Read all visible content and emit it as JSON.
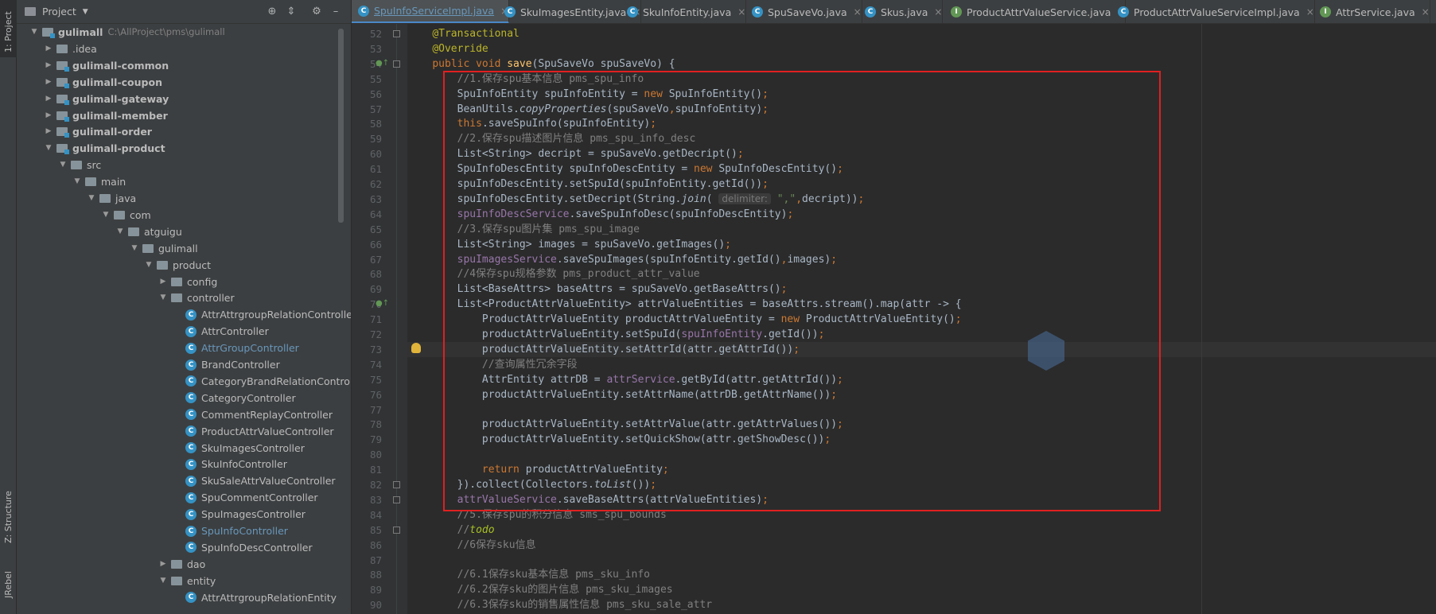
{
  "left_strip": {
    "project_tab": "1: Project",
    "structure_tab": "Z: Structure",
    "jrebel_tab": "JRebel"
  },
  "project_panel": {
    "title": "Project",
    "tree": [
      {
        "label": "gulimall",
        "path": "C:\\AllProject\\pms\\gulimall",
        "level": 0,
        "expanded": true,
        "kind": "module",
        "bold": true
      },
      {
        "label": ".idea",
        "level": 1,
        "expanded": false,
        "kind": "folder"
      },
      {
        "label": "gulimall-common",
        "level": 1,
        "expanded": false,
        "kind": "module",
        "bold": true
      },
      {
        "label": "gulimall-coupon",
        "level": 1,
        "expanded": false,
        "kind": "module",
        "bold": true
      },
      {
        "label": "gulimall-gateway",
        "level": 1,
        "expanded": false,
        "kind": "module",
        "bold": true
      },
      {
        "label": "gulimall-member",
        "level": 1,
        "expanded": false,
        "kind": "module",
        "bold": true
      },
      {
        "label": "gulimall-order",
        "level": 1,
        "expanded": false,
        "kind": "module",
        "bold": true
      },
      {
        "label": "gulimall-product",
        "level": 1,
        "expanded": true,
        "kind": "module",
        "bold": true
      },
      {
        "label": "src",
        "level": 2,
        "expanded": true,
        "kind": "folder"
      },
      {
        "label": "main",
        "level": 3,
        "expanded": true,
        "kind": "folder"
      },
      {
        "label": "java",
        "level": 4,
        "expanded": true,
        "kind": "folder"
      },
      {
        "label": "com",
        "level": 5,
        "expanded": true,
        "kind": "folder"
      },
      {
        "label": "atguigu",
        "level": 6,
        "expanded": true,
        "kind": "folder"
      },
      {
        "label": "gulimall",
        "level": 7,
        "expanded": true,
        "kind": "folder"
      },
      {
        "label": "product",
        "level": 8,
        "expanded": true,
        "kind": "folder"
      },
      {
        "label": "config",
        "level": 9,
        "expanded": false,
        "kind": "folder"
      },
      {
        "label": "controller",
        "level": 9,
        "expanded": true,
        "kind": "folder"
      },
      {
        "label": "AttrAttrgroupRelationController",
        "level": 10,
        "kind": "class"
      },
      {
        "label": "AttrController",
        "level": 10,
        "kind": "class"
      },
      {
        "label": "AttrGroupController",
        "level": 10,
        "kind": "class",
        "blue": true
      },
      {
        "label": "BrandController",
        "level": 10,
        "kind": "class"
      },
      {
        "label": "CategoryBrandRelationController",
        "level": 10,
        "kind": "class"
      },
      {
        "label": "CategoryController",
        "level": 10,
        "kind": "class"
      },
      {
        "label": "CommentReplayController",
        "level": 10,
        "kind": "class"
      },
      {
        "label": "ProductAttrValueController",
        "level": 10,
        "kind": "class"
      },
      {
        "label": "SkuImagesController",
        "level": 10,
        "kind": "class"
      },
      {
        "label": "SkuInfoController",
        "level": 10,
        "kind": "class"
      },
      {
        "label": "SkuSaleAttrValueController",
        "level": 10,
        "kind": "class"
      },
      {
        "label": "SpuCommentController",
        "level": 10,
        "kind": "class"
      },
      {
        "label": "SpuImagesController",
        "level": 10,
        "kind": "class"
      },
      {
        "label": "SpuInfoController",
        "level": 10,
        "kind": "class",
        "blue": true
      },
      {
        "label": "SpuInfoDescController",
        "level": 10,
        "kind": "class"
      },
      {
        "label": "dao",
        "level": 9,
        "expanded": false,
        "kind": "folder"
      },
      {
        "label": "entity",
        "level": 9,
        "expanded": true,
        "kind": "folder"
      },
      {
        "label": "AttrAttrgroupRelationEntity",
        "level": 10,
        "kind": "class"
      }
    ]
  },
  "tabs": [
    {
      "label": "SpuInfoServiceImpl.java",
      "icon": "C",
      "active": true
    },
    {
      "label": "SkuImagesEntity.java",
      "icon": "C"
    },
    {
      "label": "SkuInfoEntity.java",
      "icon": "C"
    },
    {
      "label": "SpuSaveVo.java",
      "icon": "C"
    },
    {
      "label": "Skus.java",
      "icon": "C"
    },
    {
      "label": "ProductAttrValueService.java",
      "icon": "I"
    },
    {
      "label": "ProductAttrValueServiceImpl.java",
      "icon": "C"
    },
    {
      "label": "AttrService.java",
      "icon": "I"
    }
  ],
  "editor": {
    "lines": [
      {
        "n": "52",
        "html": "    <span class='an'>@Transactional</span>"
      },
      {
        "n": "53",
        "html": "    <span class='an'>@Override</span>"
      },
      {
        "n": "54",
        "html": "    <span class='k'>public void</span> <span class='fn'>save</span>(SpuSaveVo spuSaveVo) {"
      },
      {
        "n": "55",
        "html": "        <span class='cm'>//1.保存spu基本信息 pms_spu_info</span>"
      },
      {
        "n": "56",
        "html": "        SpuInfoEntity spuInfoEntity = <span class='k'>new</span> SpuInfoEntity()<span class='k'>;</span>"
      },
      {
        "n": "57",
        "html": "        BeanUtils.<span class='it'>copyProperties</span>(spuSaveVo<span class='k'>,</span>spuInfoEntity)<span class='k'>;</span>"
      },
      {
        "n": "58",
        "html": "        <span class='k'>this</span>.saveSpuInfo(spuInfoEntity)<span class='k'>;</span>"
      },
      {
        "n": "59",
        "html": "        <span class='cm'>//2.保存spu描述图片信息 pms_spu_info_desc</span>"
      },
      {
        "n": "60",
        "html": "        List&lt;String&gt; decript = spuSaveVo.getDecript()<span class='k'>;</span>"
      },
      {
        "n": "61",
        "html": "        SpuInfoDescEntity spuInfoDescEntity = <span class='k'>new</span> SpuInfoDescEntity()<span class='k'>;</span>"
      },
      {
        "n": "62",
        "html": "        spuInfoDescEntity.setSpuId(spuInfoEntity.getId())<span class='k'>;</span>"
      },
      {
        "n": "63",
        "html": "        spuInfoDescEntity.setDecript(String.<span class='it'>join</span>( <span class='hint'>delimiter:</span> <span class='st'>\",\"</span><span class='k'>,</span>decript))<span class='k'>;</span>"
      },
      {
        "n": "64",
        "html": "        <span class='fd'>spuInfoDescService</span>.saveSpuInfoDesc(spuInfoDescEntity)<span class='k'>;</span>"
      },
      {
        "n": "65",
        "html": "        <span class='cm'>//3.保存spu图片集 pms_spu_image</span>"
      },
      {
        "n": "66",
        "html": "        List&lt;String&gt; images = spuSaveVo.getImages()<span class='k'>;</span>"
      },
      {
        "n": "67",
        "html": "        <span class='fd'>spuImagesService</span>.saveSpuImages(spuInfoEntity.getId()<span class='k'>,</span>images)<span class='k'>;</span>"
      },
      {
        "n": "68",
        "html": "        <span class='cm'>//4保存spu规格参数 pms_product_attr_value</span>"
      },
      {
        "n": "69",
        "html": "        List&lt;BaseAttrs&gt; baseAttrs = spuSaveVo.getBaseAttrs()<span class='k'>;</span>"
      },
      {
        "n": "70",
        "html": "        List&lt;ProductAttrValueEntity&gt; attrValueEntities = baseAttrs.stream().map(attr -&gt; {"
      },
      {
        "n": "71",
        "html": "            ProductAttrValueEntity productAttrValueEntity = <span class='k'>new</span> ProductAttrValueEntity()<span class='k'>;</span>"
      },
      {
        "n": "72",
        "html": "            productAttrValueEntity.setSpuId(<span class='fd'>spuInfoEntity</span>.getId())<span class='k'>;</span>"
      },
      {
        "n": "73",
        "html": "            productAttrValueEntity.setAttrId(attr.getAttrId())<span class='k'>;</span>",
        "highlight": true
      },
      {
        "n": "74",
        "html": "            <span class='cm'>//查询属性冗余字段</span>"
      },
      {
        "n": "75",
        "html": "            AttrEntity attrDB = <span class='fd'>attrService</span>.getById(attr.getAttrId())<span class='k'>;</span>"
      },
      {
        "n": "76",
        "html": "            productAttrValueEntity.setAttrName(attrDB.getAttrName())<span class='k'>;</span>"
      },
      {
        "n": "77",
        "html": ""
      },
      {
        "n": "78",
        "html": "            productAttrValueEntity.setAttrValue(attr.getAttrValues())<span class='k'>;</span>"
      },
      {
        "n": "79",
        "html": "            productAttrValueEntity.setQuickShow(attr.getShowDesc())<span class='k'>;</span>"
      },
      {
        "n": "80",
        "html": ""
      },
      {
        "n": "81",
        "html": "            <span class='k'>return</span> productAttrValueEntity<span class='k'>;</span>"
      },
      {
        "n": "82",
        "html": "        }).collect(Collectors.<span class='it'>toList</span>())<span class='k'>;</span>"
      },
      {
        "n": "83",
        "html": "        <span class='fd'>attrValueService</span>.saveBaseAttrs(attrValueEntities)<span class='k'>;</span>"
      },
      {
        "n": "84",
        "html": "        <span class='cm'>//5.保存spu的积分信息 sms_spu_bounds</span>"
      },
      {
        "n": "85",
        "html": "        <span class='cm'>//</span><span class='todo'>todo</span>"
      },
      {
        "n": "86",
        "html": "        <span class='cm'>//6保存sku信息</span>"
      },
      {
        "n": "87",
        "html": ""
      },
      {
        "n": "88",
        "html": "        <span class='cm'>//6.1保存sku基本信息 pms_sku_info</span>"
      },
      {
        "n": "89",
        "html": "        <span class='cm'>//6.2保存sku的图片信息 pms_sku_images</span>"
      },
      {
        "n": "90",
        "html": "        <span class='cm'>//6.3保存sku的销售属性信息 pms_sku_sale_attr</span>"
      }
    ]
  },
  "colors": {
    "accent": "#4a88c7",
    "annotation_box": "#e02020"
  }
}
